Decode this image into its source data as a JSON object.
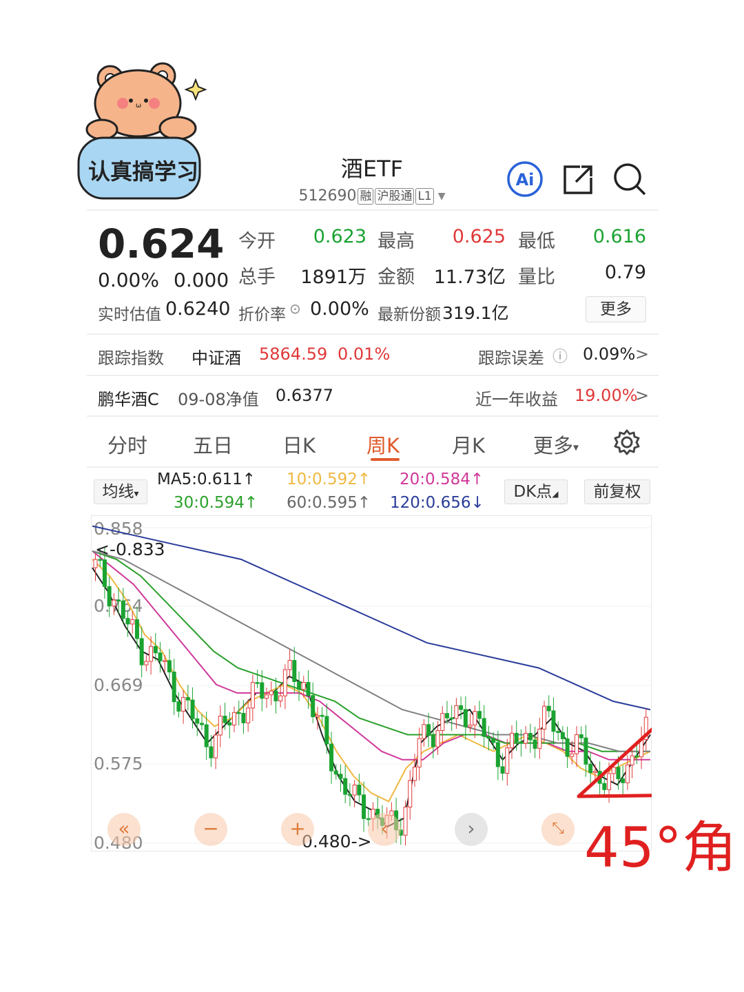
{
  "sticker": {
    "text": "认真搞学习"
  },
  "header": {
    "title": "酒ETF",
    "code": "512690",
    "tags": [
      "融",
      "沪股通",
      "L1"
    ]
  },
  "quote": {
    "price": "0.624",
    "change_pct": "0.00%",
    "change": "0.000",
    "open_label": "今开",
    "open": "0.623",
    "high_label": "最高",
    "high": "0.625",
    "low_label": "最低",
    "low": "0.616",
    "vol_label": "总手",
    "vol": "1891万",
    "amount_label": "金额",
    "amount": "11.73亿",
    "ratio_label": "量比",
    "ratio": "0.79",
    "iopv_label": "实时估值",
    "iopv": "0.6240",
    "discount_label": "折价率",
    "discount": "0.00%",
    "shares_label": "最新份额",
    "shares": "319.1亿",
    "more_label": "更多"
  },
  "tracking": {
    "index_label": "跟踪指数",
    "index_name": "中证酒",
    "index_value": "5864.59",
    "index_change": "0.01%",
    "error_label": "跟踪误差",
    "error_value": "0.09%",
    "fund_name": "鹏华酒C",
    "nav_label": "09-08净值",
    "nav_value": "0.6377",
    "return_label": "近一年收益",
    "return_value": "19.00%"
  },
  "tabs": [
    "分时",
    "五日",
    "日K",
    "周K",
    "月K",
    "更多"
  ],
  "ma": {
    "selector": "均线",
    "ma5": "MA5:0.611↑",
    "ma10": "10:0.592↑",
    "ma20": "20:0.584↑",
    "ma30": "30:0.594↑",
    "ma60": "60:0.595↑",
    "ma120": "120:0.656↓",
    "dk_label": "DK点",
    "adj_label": "前复权"
  },
  "colors": {
    "up": "#e03838",
    "down": "#1aa331",
    "ma5": "#222222",
    "ma10": "#f0b840",
    "ma20": "#d0389a",
    "ma30": "#2aa02a",
    "ma60": "#808080",
    "ma120": "#2a3c9a"
  },
  "chart_data": {
    "type": "candlestick",
    "y_ticks": [
      "0.858",
      "0.764",
      "0.669",
      "0.575",
      "0.480"
    ],
    "ylim": [
      0.48,
      0.858
    ],
    "max_marker": "<-0.833",
    "min_marker": "0.480->",
    "annotation": "45°角",
    "ma_lines": [
      {
        "name": "MA5",
        "values": [
          0.81,
          0.78,
          0.74,
          0.71,
          0.7,
          0.66,
          0.63,
          0.6,
          0.62,
          0.64,
          0.66,
          0.66,
          0.68,
          0.67,
          0.61,
          0.56,
          0.53,
          0.52,
          0.5,
          0.51,
          0.6,
          0.62,
          0.63,
          0.64,
          0.61,
          0.58,
          0.6,
          0.61,
          0.63,
          0.6,
          0.59,
          0.56,
          0.55,
          0.58,
          0.61
        ]
      },
      {
        "name": "MA10",
        "values": [
          0.82,
          0.8,
          0.77,
          0.73,
          0.71,
          0.67,
          0.64,
          0.62,
          0.63,
          0.65,
          0.66,
          0.67,
          0.66,
          0.63,
          0.59,
          0.56,
          0.54,
          0.53,
          0.57,
          0.59,
          0.6,
          0.61,
          0.6,
          0.59,
          0.6,
          0.61,
          0.6,
          0.59,
          0.57,
          0.56,
          0.57,
          0.58,
          0.59
        ]
      },
      {
        "name": "MA20",
        "values": [
          0.83,
          0.81,
          0.79,
          0.76,
          0.73,
          0.7,
          0.67,
          0.66,
          0.66,
          0.66,
          0.66,
          0.65,
          0.63,
          0.61,
          0.59,
          0.58,
          0.58,
          0.6,
          0.61,
          0.61,
          0.6,
          0.6,
          0.6,
          0.59,
          0.59,
          0.58,
          0.58,
          0.58
        ]
      },
      {
        "name": "MA30",
        "values": [
          0.83,
          0.82,
          0.8,
          0.77,
          0.74,
          0.71,
          0.69,
          0.68,
          0.67,
          0.66,
          0.65,
          0.63,
          0.62,
          0.61,
          0.61,
          0.61,
          0.61,
          0.6,
          0.6,
          0.6,
          0.6,
          0.59,
          0.59,
          0.59
        ]
      },
      {
        "name": "MA60",
        "values": [
          0.83,
          0.82,
          0.8,
          0.78,
          0.76,
          0.74,
          0.72,
          0.7,
          0.68,
          0.66,
          0.64,
          0.63,
          0.62,
          0.61,
          0.61,
          0.6,
          0.6,
          0.59,
          0.59
        ]
      },
      {
        "name": "MA120",
        "values": [
          0.86,
          0.85,
          0.84,
          0.83,
          0.82,
          0.8,
          0.78,
          0.76,
          0.74,
          0.72,
          0.71,
          0.7,
          0.69,
          0.67,
          0.65,
          0.64
        ]
      }
    ]
  }
}
